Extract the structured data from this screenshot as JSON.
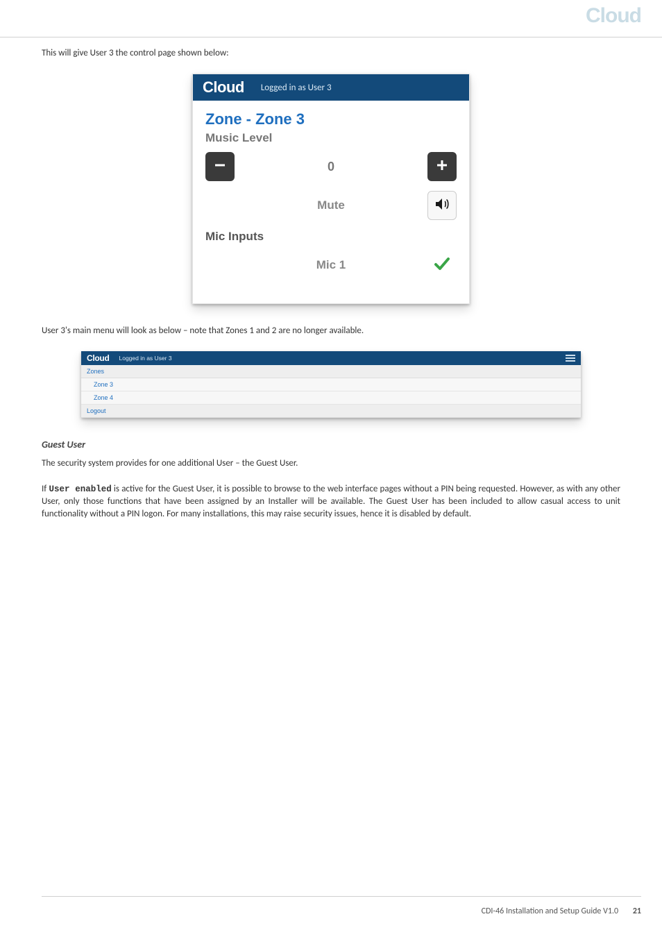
{
  "brand": {
    "logo_text": "Cloud"
  },
  "intro_text": "This will give User 3 the control page shown below:",
  "panel1": {
    "header": {
      "logo": "Cloud",
      "status": "Logged in as User 3"
    },
    "title": "Zone - Zone 3",
    "music_level": {
      "label": "Music Level",
      "value": "0",
      "minus_icon_name": "minus-icon",
      "plus_icon_name": "plus-icon",
      "mute_label": "Mute",
      "speaker_icon_name": "speaker-icon"
    },
    "mic_inputs": {
      "label": "Mic Inputs",
      "items": [
        {
          "label": "Mic 1",
          "checked_icon_name": "checkmark-icon"
        }
      ]
    }
  },
  "between_text": "User 3's main menu will look as below – note that Zones 1 and 2 are no longer available.",
  "panel2": {
    "header": {
      "logo": "Cloud",
      "status": "Logged in as User 3"
    },
    "groups": [
      {
        "label": "Zones",
        "items": [
          "Zone 3",
          "Zone 4"
        ]
      },
      {
        "label": "Logout",
        "items": []
      }
    ]
  },
  "guest_user": {
    "heading": "Guest User",
    "para1": "The security system provides for one additional User – the Guest User.",
    "para2_pre": "If ",
    "para2_code": "User enabled",
    "para2_post": " is active for the Guest User, it is possible to browse to the web interface pages without a PIN being requested. However, as with any other User, only those functions that have been assigned by an Installer will be available. The Guest User has been included to allow casual access to unit functionality without a PIN logon. For many installations, this may raise security issues, hence it is disabled by default."
  },
  "footer": {
    "doc": "CDI-46 Installation and Setup Guide V1.0",
    "page": "21"
  }
}
